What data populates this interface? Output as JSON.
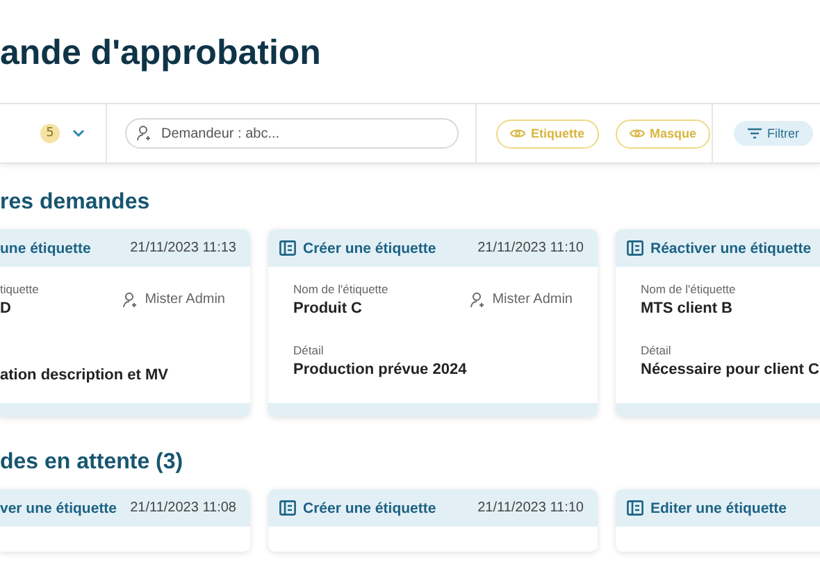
{
  "title": "ande d'approbation",
  "toolbar": {
    "count": "5",
    "search": {
      "placeholder": "Demandeur : abc..."
    },
    "buttons": [
      {
        "label": "Etiquette",
        "kind": "outline"
      },
      {
        "label": "Masque",
        "kind": "outline"
      },
      {
        "label": "Filtrer",
        "kind": "filter"
      }
    ]
  },
  "sections": [
    {
      "title": "res demandes",
      "cards": [
        {
          "kind": "clipped",
          "action": "une étiquette",
          "date": "21/11/2023 11:13",
          "name_label": "tiquette",
          "name": "D",
          "requester": "Mister Admin",
          "detail": "ation description et MV"
        },
        {
          "kind": "full",
          "action": "Créer une étiquette",
          "date": "21/11/2023 11:10",
          "name_label": "Nom de l'étiquette",
          "name": "Produit C",
          "requester": "Mister Admin",
          "detail_label": "Détail",
          "detail": "Production prévue 2024"
        },
        {
          "kind": "full",
          "action": "Réactiver une étiquette",
          "name_label": "Nom de l'étiquette",
          "name": "MTS client B",
          "detail_label": "Détail",
          "detail": "Nécessaire pour client C"
        }
      ]
    },
    {
      "title": "des en attente (3)",
      "cards": [
        {
          "kind": "clipped",
          "action": "ver une étiquette",
          "date": "21/11/2023 11:08"
        },
        {
          "kind": "full",
          "action": "Créer une étiquette",
          "date": "21/11/2023 11:10"
        },
        {
          "kind": "full",
          "action": "Editer une étiquette"
        }
      ]
    }
  ]
}
